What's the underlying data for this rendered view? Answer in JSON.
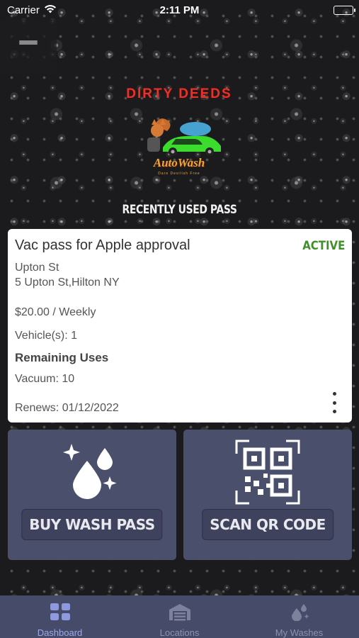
{
  "status_bar": {
    "carrier": "Carrier",
    "time": "2:11 PM",
    "icons": [
      "wifi-icon",
      "battery-icon"
    ]
  },
  "header": {
    "menu_icon": "hamburger-icon"
  },
  "logo": {
    "top_text": "DIRTY DEEDS",
    "script_text": "AutoWash",
    "tagline": "Dare Devilish Free"
  },
  "section": {
    "title": "RECENTLY USED PASS"
  },
  "pass_card": {
    "name": "Vac pass for Apple approval",
    "status": "ACTIVE",
    "status_color": "#3f8f2b",
    "location_name": "Upton St",
    "address": "5 Upton St,Hilton NY",
    "price": "$20.00 / Weekly",
    "vehicles": "Vehicle(s): 1",
    "remaining_heading": "Remaining Uses",
    "vacuum": "Vacuum: 10",
    "renews": "Renews: 01/12/2022",
    "more_icon": "more-vertical-icon"
  },
  "actions": {
    "buy": {
      "label": "BUY WASH PASS",
      "icon": "sparkling-drops-icon"
    },
    "scan": {
      "label": "SCAN QR CODE",
      "icon": "qr-code-icon"
    }
  },
  "tab_bar": {
    "tabs": [
      {
        "label": "Dashboard",
        "icon": "grid-icon",
        "active": true
      },
      {
        "label": "Locations",
        "icon": "garage-icon",
        "active": false
      },
      {
        "label": "My Washes",
        "icon": "drops-icon",
        "active": false
      }
    ]
  },
  "colors": {
    "tile": "#4a4f6c",
    "tab_bar": "#474b6a",
    "active_tab": "#9ea8e8"
  }
}
